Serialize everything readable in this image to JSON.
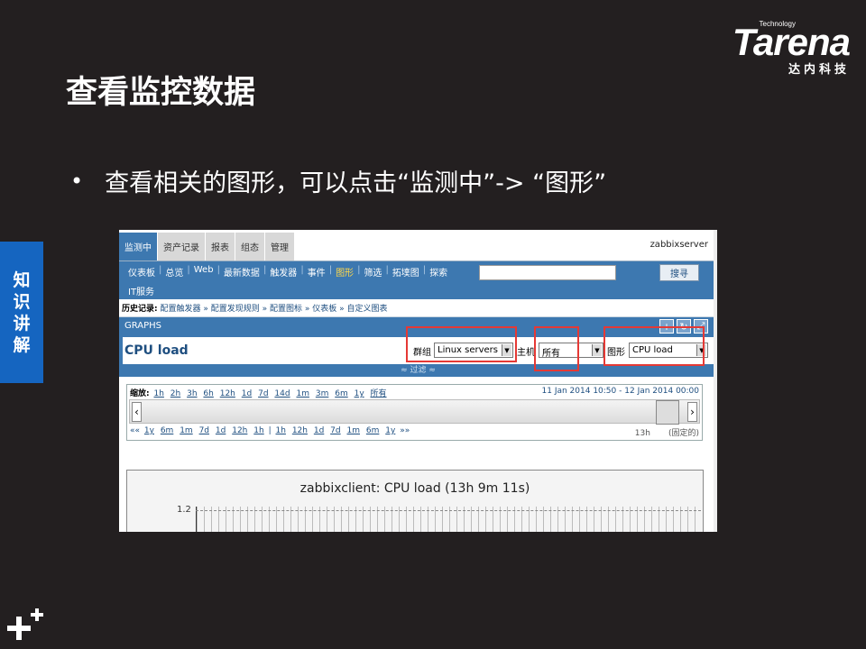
{
  "logo": {
    "small": "Technology",
    "main": "Tarena",
    "sub": "达内科技"
  },
  "slide": {
    "title": "查看监控数据",
    "bullet": "查看相关的图形，可以点击“监测中”-> “图形”"
  },
  "side_tab": [
    "知",
    "识",
    "讲",
    "解"
  ],
  "app": {
    "main_tabs": [
      "监测中",
      "资产记录",
      "报表",
      "组态",
      "管理"
    ],
    "server_name": "zabbixserver",
    "sub_nav_row1": [
      "仪表板",
      "总览",
      "Web",
      "最新数据",
      "触发器",
      "事件",
      "图形",
      "筛选",
      "拓墣图",
      "探索"
    ],
    "sub_nav_row2": [
      "IT服务"
    ],
    "search_button": "搜寻",
    "history_label": "历史记录:",
    "history_items": [
      "配置触发器",
      "配置发现规则",
      "配置图标",
      "仪表板",
      "自定义图表"
    ],
    "graphs_header": "GRAPHS",
    "graph_name": "CPU load",
    "filter": {
      "group_label": "群组",
      "group_value": "Linux servers",
      "host_label": "主机",
      "host_value": "所有",
      "graph_label": "图形",
      "graph_value": "CPU load"
    },
    "filter_toggle": "≈ 过滤 ≈",
    "zoom": {
      "label": "缩放:",
      "options": [
        "1h",
        "2h",
        "3h",
        "6h",
        "12h",
        "1d",
        "7d",
        "14d",
        "1m",
        "3m",
        "6m",
        "1y",
        "所有"
      ],
      "date_from": "11 Jan 2014 10:50",
      "date_sep": "-",
      "date_to": "12 Jan 2014 00:00",
      "back_label": "««",
      "back_options": [
        "1y",
        "6m",
        "1m",
        "7d",
        "1d",
        "12h",
        "1h"
      ],
      "sep": "|",
      "forward_options": [
        "1h",
        "12h",
        "1d",
        "7d",
        "1m",
        "6m",
        "1y"
      ],
      "forward_label": "»»",
      "period": "13h",
      "fixed": "(固定的)"
    },
    "chart": {
      "title": "zabbixclient: CPU load (13h 9m 11s)",
      "ytick": "1.2"
    }
  }
}
